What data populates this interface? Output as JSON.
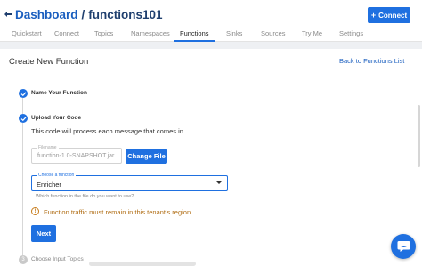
{
  "header": {
    "breadcrumb_link": "Dashboard",
    "separator": "/",
    "current": "functions101",
    "connect_label": "Connect"
  },
  "tabs": [
    {
      "label": "Quickstart"
    },
    {
      "label": "Connect"
    },
    {
      "label": "Topics"
    },
    {
      "label": "Namespaces"
    },
    {
      "label": "Functions",
      "active": true
    },
    {
      "label": "Sinks"
    },
    {
      "label": "Sources"
    },
    {
      "label": "Try Me"
    },
    {
      "label": "Settings"
    }
  ],
  "panel": {
    "title": "Create New Function",
    "back_link": "Back to Functions List"
  },
  "steps": [
    {
      "label": "Name Your Function",
      "status": "complete"
    },
    {
      "label": "Upload Your Code",
      "status": "complete"
    },
    {
      "number": "3",
      "label": "Choose Input Topics",
      "status": "pending"
    }
  ],
  "upload": {
    "description": "This code will process each message that comes in",
    "file_label": "Filename",
    "file_value": "function-1.0-SNAPSHOT.jar",
    "change_file_label": "Change File",
    "select_label": "Choose a function",
    "select_value": "Enricher",
    "select_helper": "Which function in the file do you want to use?",
    "warning": "Function traffic must remain in this tenant's region.",
    "next_label": "Next"
  },
  "colors": {
    "accent": "#1f70e0",
    "warning": "#b06d14"
  },
  "icons": {
    "back": "arrow-back-icon",
    "plus": "plus-icon",
    "check": "check-icon",
    "warning": "info-icon",
    "chat": "chat-icon"
  }
}
